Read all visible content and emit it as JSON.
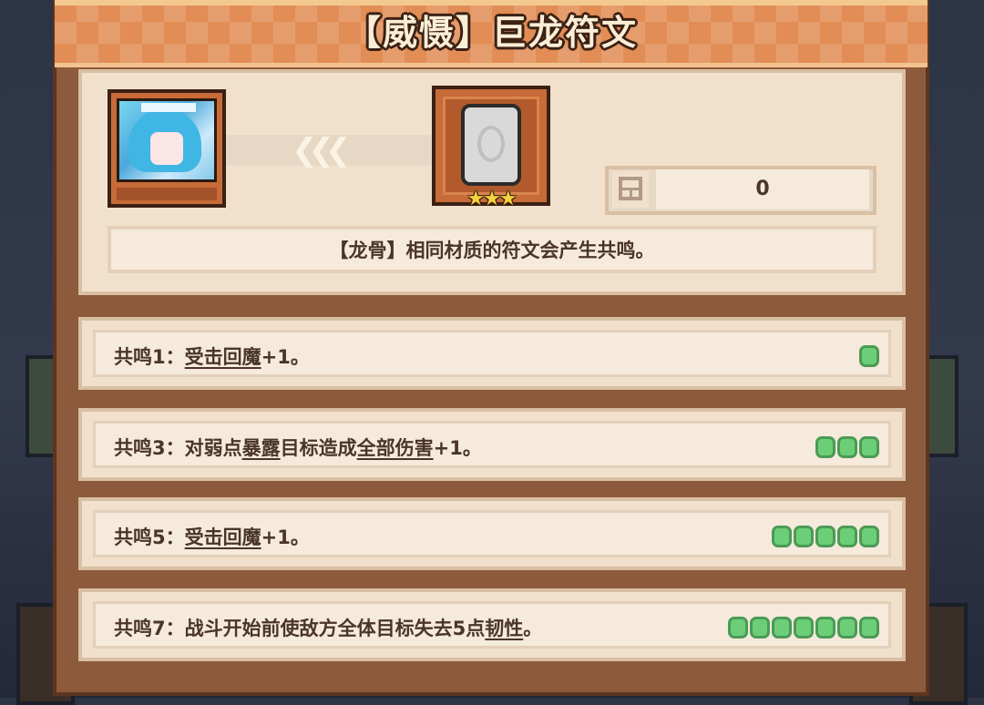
{
  "title": "【威慑】巨龙符文",
  "hero": {
    "name": "hero-portrait"
  },
  "rune": {
    "stars": "★★★"
  },
  "count": {
    "value": "0"
  },
  "description": "【龙骨】相同材质的符文会产生共鸣。",
  "resonances": [
    {
      "prefix": "共鸣1：",
      "parts": [
        {
          "text": "受击回魔",
          "u": true
        },
        {
          "text": "+1。",
          "u": false
        }
      ],
      "dots": 1
    },
    {
      "prefix": "共鸣3：",
      "parts": [
        {
          "text": "对弱点",
          "u": false
        },
        {
          "text": "暴露",
          "u": true
        },
        {
          "text": "目标造成",
          "u": false
        },
        {
          "text": "全部伤害",
          "u": true
        },
        {
          "text": "+1。",
          "u": false
        }
      ],
      "dots": 3
    },
    {
      "prefix": "共鸣5：",
      "parts": [
        {
          "text": "受击回魔",
          "u": true
        },
        {
          "text": "+1。",
          "u": false
        }
      ],
      "dots": 5
    },
    {
      "prefix": "共鸣7：",
      "parts": [
        {
          "text": "战斗开始前使敌方全体目标失去5点",
          "u": false
        },
        {
          "text": "韧性",
          "u": true
        },
        {
          "text": "。",
          "u": false
        }
      ],
      "dots": 7
    }
  ],
  "colors": {
    "header": "#e28d55",
    "panel": "#8d5a3b",
    "card": "#f1e1cc",
    "dot": "#6ccf78",
    "star": "#f5d33a"
  }
}
